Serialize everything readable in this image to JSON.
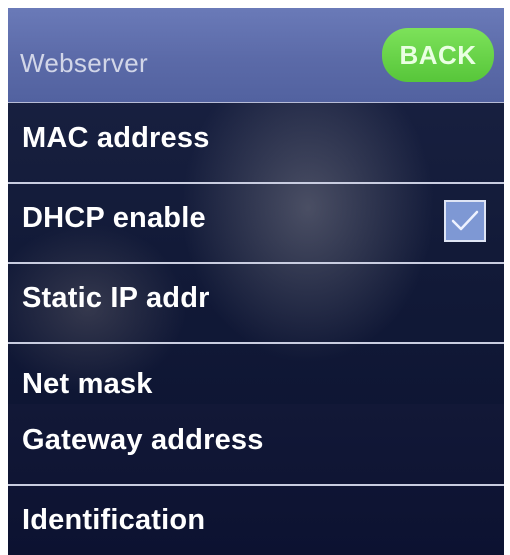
{
  "header": {
    "title": "Webserver",
    "back_label": "BACK"
  },
  "menu": {
    "items": [
      {
        "label": "MAC address"
      },
      {
        "label": "DHCP enable",
        "checked": true
      },
      {
        "label": "Static IP addr"
      },
      {
        "label": "Net mask"
      },
      {
        "label": "Gateway address"
      },
      {
        "label": "Identification"
      }
    ]
  },
  "colors": {
    "header_bg": "#5b6aa8",
    "back_button": "#57c63a",
    "screen_bg": "#121a38",
    "checkbox_fill": "#7e98d4"
  },
  "icons": {
    "checkbox": "checkmark-icon"
  }
}
